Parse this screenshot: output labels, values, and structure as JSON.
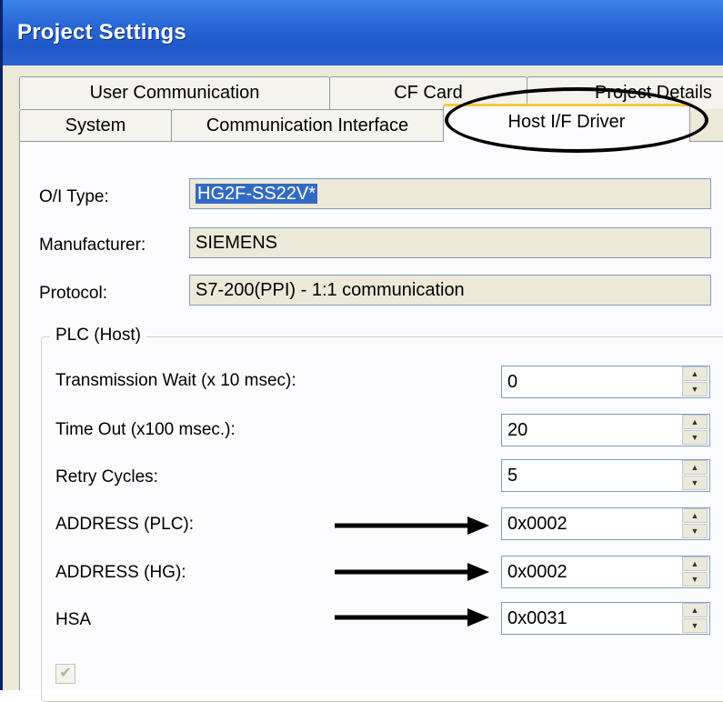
{
  "window": {
    "title": "Project Settings"
  },
  "tabs": {
    "back_row": [
      {
        "label": "User Communication"
      },
      {
        "label": "CF Card"
      },
      {
        "label": "Project Details"
      }
    ],
    "front_row": [
      {
        "label": "System"
      },
      {
        "label": "Communication Interface"
      },
      {
        "label": "Host I/F Driver",
        "active": true
      }
    ]
  },
  "info": {
    "oi_type": {
      "label": "O/I Type:",
      "value": "HG2F-SS22V*"
    },
    "manufacturer": {
      "label": "Manufacturer:",
      "value": "SIEMENS"
    },
    "protocol": {
      "label": "Protocol:",
      "value": "S7-200(PPI) - 1:1 communication"
    }
  },
  "plc_host": {
    "group_label": "PLC (Host)",
    "fields": [
      {
        "label": "Transmission Wait (x 10 msec):",
        "value": "0"
      },
      {
        "label": "Time Out (x100 msec.):",
        "value": "20"
      },
      {
        "label": "Retry Cycles:",
        "value": "5"
      },
      {
        "label": "ADDRESS (PLC):",
        "value": "0x0002"
      },
      {
        "label": "ADDRESS (HG):",
        "value": "0x0002"
      },
      {
        "label": "HSA",
        "value": "0x0031"
      }
    ],
    "checkbox_checked": true
  },
  "annotations": {
    "icons": [
      "arrow-right-icon",
      "highlight-oval"
    ]
  },
  "colors": {
    "titlebar": "#2866d6",
    "active_tab_accent": "#ffc83c",
    "selection": "#316ac5"
  }
}
